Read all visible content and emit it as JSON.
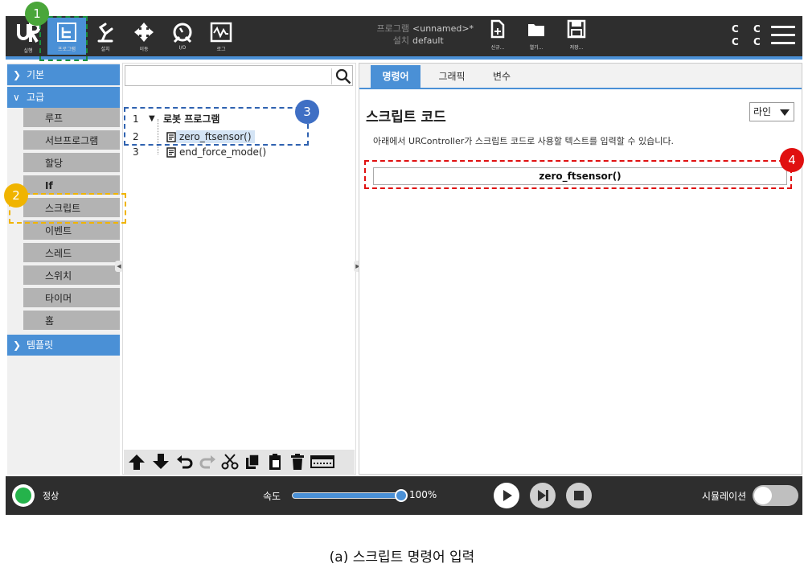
{
  "topbar": {
    "nav": [
      {
        "id": "run",
        "label": "실행"
      },
      {
        "id": "program",
        "label": "프로그램"
      },
      {
        "id": "installation",
        "label": "설치"
      },
      {
        "id": "move",
        "label": "이동"
      },
      {
        "id": "io",
        "label": "I/O"
      },
      {
        "id": "log",
        "label": "로그"
      }
    ],
    "program_key": "프로그램",
    "program_value": "<unnamed>*",
    "installation_key": "설치",
    "installation_value": "default",
    "file_buttons": [
      {
        "id": "new",
        "label": "신규..."
      },
      {
        "id": "open",
        "label": "열기..."
      },
      {
        "id": "save",
        "label": "저장..."
      }
    ],
    "cc_line1": "C C",
    "cc_line2": "C C"
  },
  "left_panel": {
    "basic": "기본",
    "advanced": "고급",
    "items": [
      "루프",
      "서브프로그램",
      "할당",
      "If",
      "스크립트",
      "이벤트",
      "스레드",
      "스위치",
      "타이머",
      "홈"
    ],
    "templates": "템플릿"
  },
  "tree": {
    "rows": [
      {
        "num": "1",
        "label": "로봇 프로그램"
      },
      {
        "num": "2",
        "label": "zero_ftsensor()"
      },
      {
        "num": "3",
        "label": "end_force_mode()"
      }
    ]
  },
  "right_panel": {
    "tabs": [
      "명령어",
      "그래픽",
      "변수"
    ],
    "title": "스크립트 코드",
    "mode": "라인",
    "description": "아래에서 URController가 스크립트 코드로 사용할 텍스트를 입력할 수 있습니다.",
    "script_value": "zero_ftsensor()"
  },
  "annotations": {
    "badge1": "1",
    "badge2": "2",
    "badge3": "3",
    "badge4": "4",
    "color1": "#1a8f3c",
    "color2": "#f0b400",
    "color3": "#2f62b0",
    "color4": "#e01010"
  },
  "footer": {
    "status": "정상",
    "speed_label": "속도",
    "speed_value": "100%",
    "speed_fraction": 1.0,
    "simulation_label": "시뮬레이션"
  },
  "caption": "(a) 스크립트 명령어 입력"
}
